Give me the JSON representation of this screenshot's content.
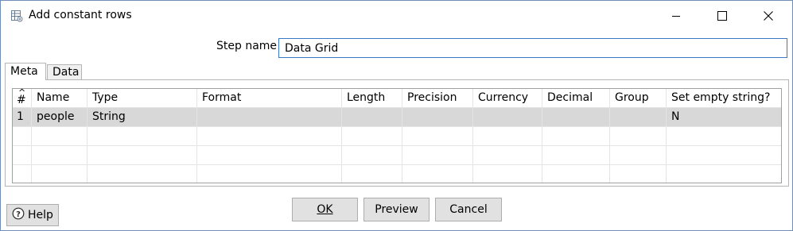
{
  "window": {
    "title": "Add constant rows",
    "icon": "grid-table-icon",
    "controls": [
      "minimize-icon",
      "maximize-icon",
      "close-icon"
    ]
  },
  "step_name": {
    "label": "Step name",
    "value": "Data Grid"
  },
  "tabs": [
    {
      "label": "Meta",
      "active": true
    },
    {
      "label": "Data",
      "active": false
    }
  ],
  "grid": {
    "sort_indicator": "^",
    "columns": [
      "#",
      "Name",
      "Type",
      "Format",
      "Length",
      "Precision",
      "Currency",
      "Decimal",
      "Group",
      "Set empty string?"
    ],
    "rows": [
      [
        "1",
        "people",
        "String",
        "",
        "",
        "",
        "",
        "",
        "",
        "N"
      ],
      [
        "",
        "",
        "",
        "",
        "",
        "",
        "",
        "",
        "",
        ""
      ],
      [
        "",
        "",
        "",
        "",
        "",
        "",
        "",
        "",
        "",
        ""
      ],
      [
        "",
        "",
        "",
        "",
        "",
        "",
        "",
        "",
        "",
        ""
      ]
    ]
  },
  "buttons": {
    "ok": "OK",
    "preview": "Preview",
    "cancel": "Cancel",
    "help": "Help"
  }
}
